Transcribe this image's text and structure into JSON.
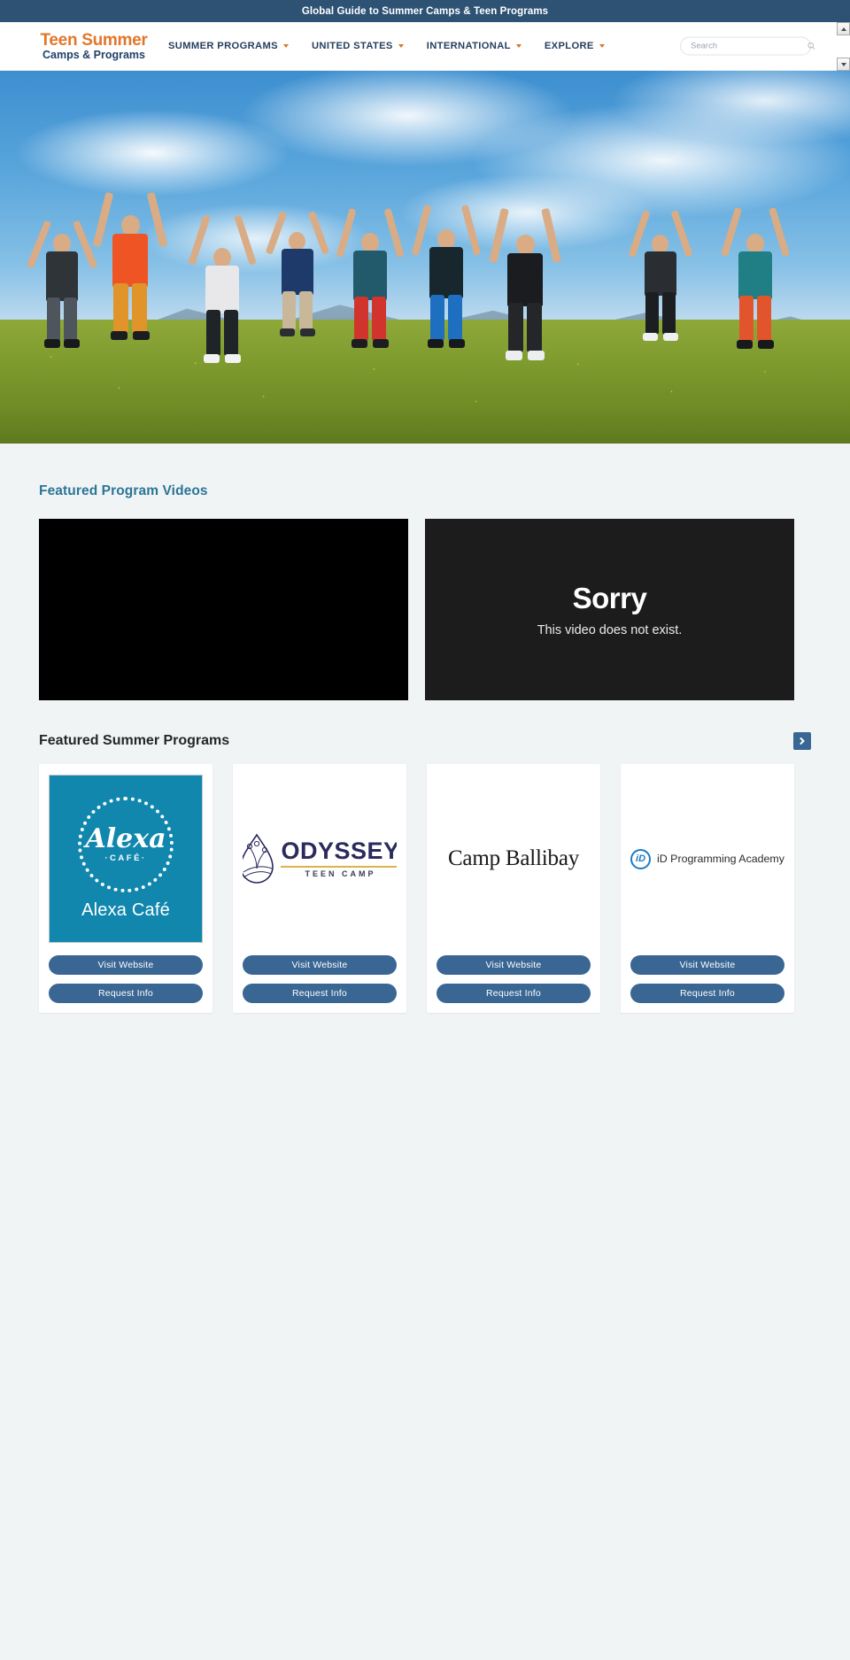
{
  "topbar": {
    "tagline": "Global Guide to Summer Camps & Teen Programs"
  },
  "header": {
    "logo": {
      "line1": "Teen Summer",
      "line2": "Camps & Programs"
    },
    "nav": [
      {
        "label": "SUMMER PROGRAMS",
        "has_dropdown": true
      },
      {
        "label": "UNITED STATES",
        "has_dropdown": true
      },
      {
        "label": "INTERNATIONAL",
        "has_dropdown": true
      },
      {
        "label": "EXPLORE",
        "has_dropdown": true
      }
    ],
    "search": {
      "placeholder": "Search",
      "value": "",
      "icon": "search-icon"
    }
  },
  "hero": {
    "alt": "Group of teens jumping with arms raised on an alpine meadow with mountains and blue sky"
  },
  "videos": {
    "section_title": "Featured Program Videos",
    "panels": [
      {
        "state": "blank",
        "title": "",
        "subtitle": ""
      },
      {
        "state": "error",
        "title": "Sorry",
        "subtitle": "This video does not exist."
      }
    ]
  },
  "programs": {
    "section_title": "Featured Summer Programs",
    "next_icon": "chevron-right-icon",
    "buttons": {
      "visit": "Visit Website",
      "request": "Request Info"
    },
    "cards": [
      {
        "name": "Alexa Café",
        "logo_style": "alexa",
        "logo_script": "Alexa",
        "logo_small": "·CAFÉ·",
        "logo_caption": "Alexa Café",
        "visit_label": "Visit Website",
        "request_label": "Request Info"
      },
      {
        "name": "Odyssey Teen Camp",
        "logo_style": "odyssey",
        "logo_main": "ODYSSEY",
        "logo_sub": "TEEN CAMP",
        "visit_label": "Visit Website",
        "request_label": "Request Info"
      },
      {
        "name": "Camp Ballibay",
        "logo_style": "ballibay",
        "logo_main": "Camp Ballibay",
        "visit_label": "Visit Website",
        "request_label": "Request Info"
      },
      {
        "name": "iD Programming Academy",
        "logo_style": "id",
        "logo_badge": "iD",
        "logo_main": "iD Programming Academy",
        "visit_label": "Visit Website",
        "request_label": "Request Info"
      }
    ]
  },
  "colors": {
    "topbar_bg": "#2d5274",
    "logo_orange": "#e2762a",
    "logo_navy": "#22416a",
    "nav_text": "#253f5e",
    "caret_orange": "#d4762f",
    "videos_title": "#2b7596",
    "programs_title": "#222729",
    "button_blue": "#3a6694",
    "page_bg": "#f1f4f5",
    "alexa_bg": "#1187ae",
    "odyssey_navy": "#2b2a5e",
    "id_blue": "#1c7bc4"
  }
}
